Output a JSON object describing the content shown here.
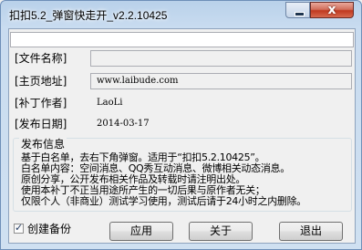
{
  "window": {
    "title": "扣扣5.2_弹窗快走开_v2.2.10425"
  },
  "titlebar": {
    "minimize_icon": "minimize-icon",
    "close_icon": "close-icon",
    "close_glyph": "x"
  },
  "fields": [
    {
      "label": "[文件名称]",
      "value": ""
    },
    {
      "label": "[主页地址]",
      "value": "www.laibude.com"
    },
    {
      "label": "[补丁作者]",
      "value": "LaoLi"
    },
    {
      "label": "[发布日期]",
      "value": "2014-03-17"
    }
  ],
  "notes": {
    "title": "发布信息",
    "lines": [
      "基于白名单，去右下角弹窗。适用于“扣扣5.2.10425”。",
      "白名单内容：空间消息、QQ秀互动消息、微博相关动态消息。",
      "原创分享，公开发布相关作品及转载时请注明出处。",
      "使用本补丁不正当用途所产生的一切后果与原作者无关；",
      "仅限个人（非商业）测试学习使用，测试后请于24小时之内删除。"
    ]
  },
  "footer": {
    "checkbox_label": "创建备份",
    "checkbox_checked": true,
    "apply_label": "应用",
    "about_label": "关于",
    "exit_label": "退出"
  }
}
